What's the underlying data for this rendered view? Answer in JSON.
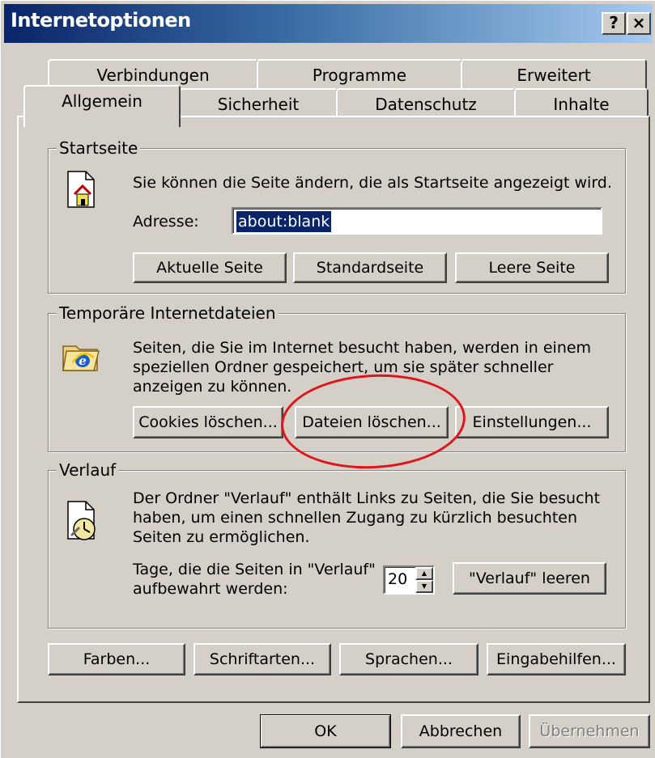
{
  "window": {
    "title": "Internetoptionen",
    "help_button": "?",
    "close_button": "×"
  },
  "tabs": {
    "row1": [
      "Verbindungen",
      "Programme",
      "Erweitert"
    ],
    "row2": [
      "Allgemein",
      "Sicherheit",
      "Datenschutz",
      "Inhalte"
    ],
    "active": "Allgemein"
  },
  "startseite": {
    "legend": "Startseite",
    "description": "Sie können die Seite ändern, die als Startseite angezeigt wird.",
    "address_label": "Adresse:",
    "address_value": "about:blank",
    "buttons": [
      "Aktuelle Seite",
      "Standardseite",
      "Leere Seite"
    ]
  },
  "temp_files": {
    "legend": "Temporäre Internetdateien",
    "description_lines": [
      "Seiten, die Sie im Internet besucht haben, werden in einem",
      "speziellen Ordner gespeichert, um sie später schneller",
      "anzeigen zu können."
    ],
    "buttons": [
      "Cookies löschen...",
      "Dateien löschen...",
      "Einstellungen..."
    ]
  },
  "verlauf": {
    "legend": "Verlauf",
    "description_lines": [
      "Der Ordner \"Verlauf\" enthält Links zu Seiten, die Sie besucht",
      "haben, um einen schnellen Zugang zu kürzlich besuchten",
      "Seiten zu ermöglichen."
    ],
    "days_label_lines": [
      "Tage, die die Seiten in \"Verlauf\"",
      "aufbewahrt werden:"
    ],
    "days_value": "20",
    "clear_button": "\"Verlauf\" leeren"
  },
  "bottom_buttons": [
    "Farben...",
    "Schriftarten...",
    "Sprachen...",
    "Eingabehilfen..."
  ],
  "dialog_buttons": {
    "ok": "OK",
    "cancel": "Abbrechen",
    "apply": "Übernehmen"
  },
  "highlight_color": "#e0141b",
  "title_color": "#0a246a"
}
